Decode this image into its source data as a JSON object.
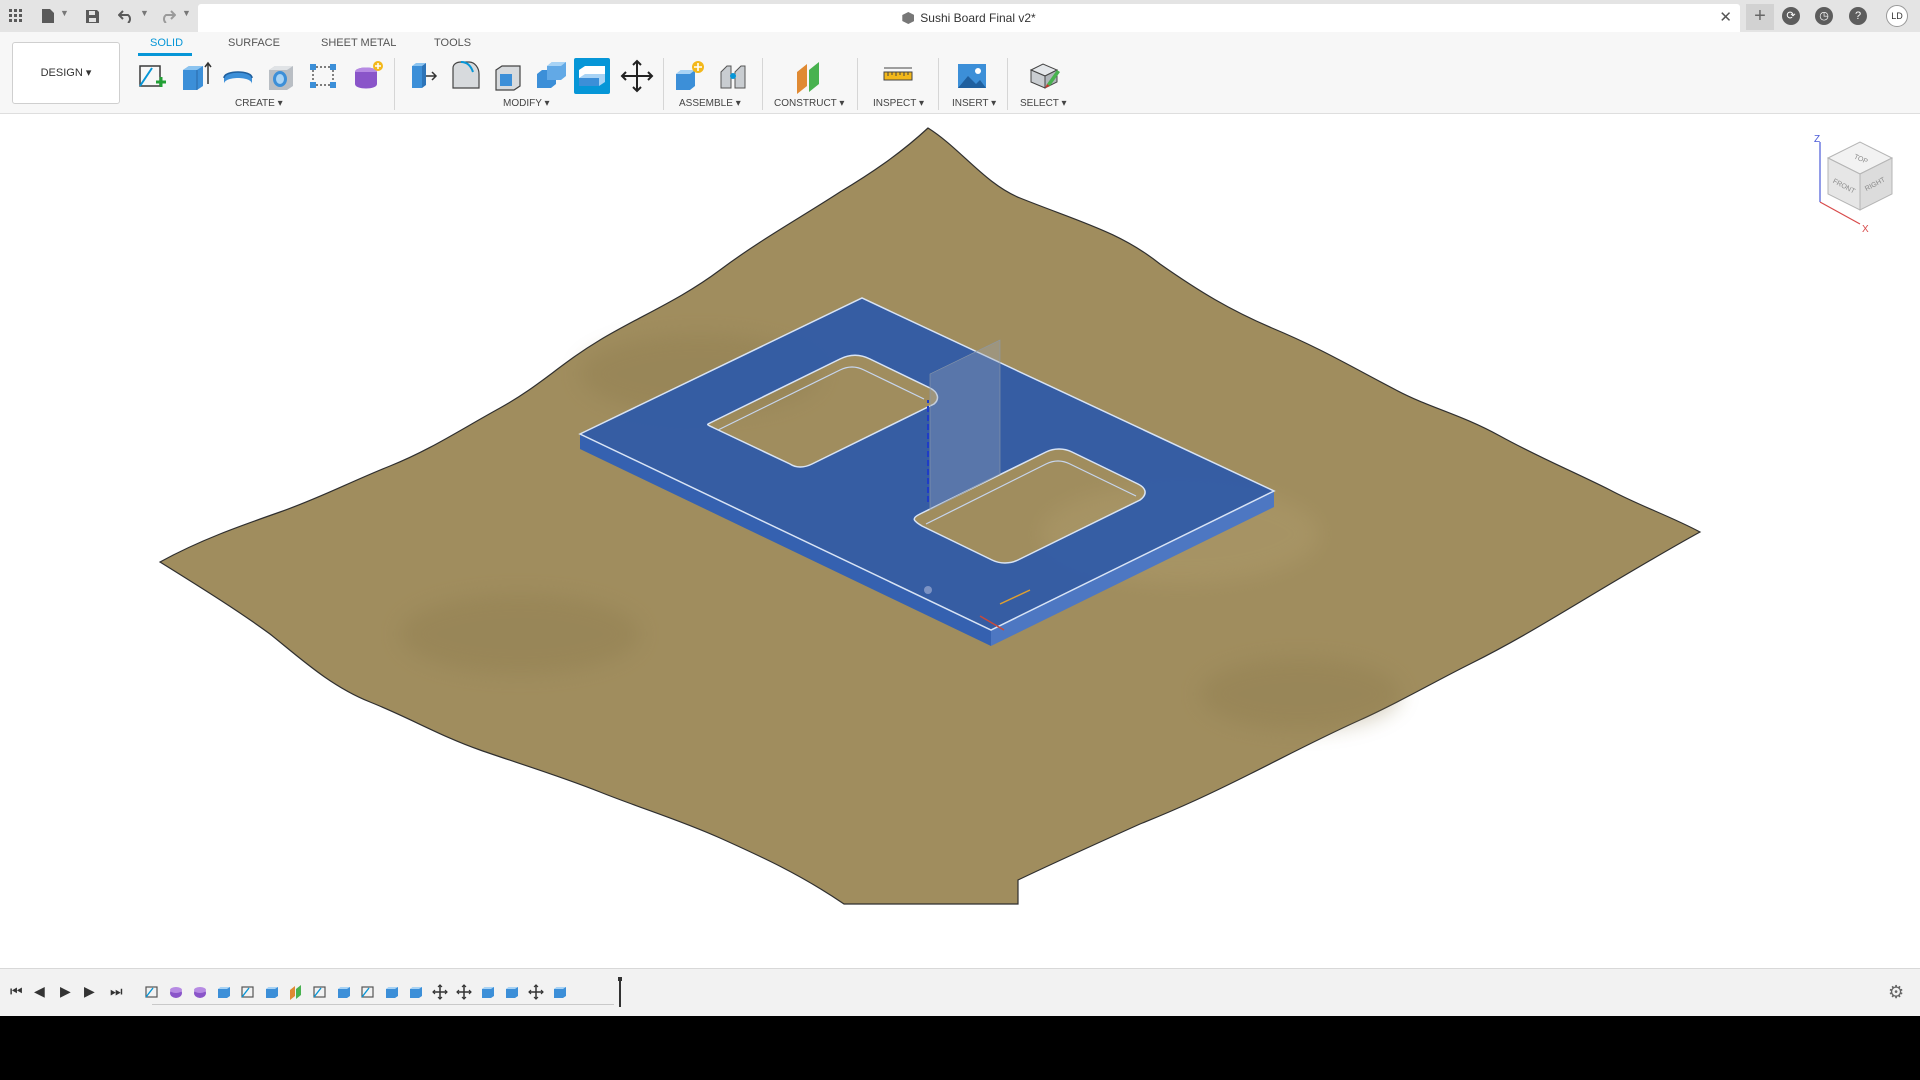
{
  "titlebar": {
    "document_title": "Sushi Board Final v2*",
    "user_initials": "LD",
    "icons": [
      "apps-grid-icon",
      "file-icon",
      "save-icon",
      "undo-icon",
      "redo-icon",
      "close-icon",
      "plus-icon",
      "extensions-icon",
      "job-status-icon",
      "help-icon"
    ]
  },
  "toolbar": {
    "workspace_label": "DESIGN",
    "tabs": [
      {
        "label": "SOLID",
        "active": true
      },
      {
        "label": "SURFACE",
        "active": false
      },
      {
        "label": "SHEET METAL",
        "active": false
      },
      {
        "label": "TOOLS",
        "active": false
      }
    ],
    "groups": {
      "create": "CREATE",
      "modify": "MODIFY",
      "assemble": "ASSEMBLE",
      "construct": "CONSTRUCT",
      "inspect": "INSPECT",
      "insert": "INSERT",
      "select": "SELECT"
    },
    "tools": {
      "create": [
        "create-sketch-icon",
        "extrude-icon",
        "revolve-icon",
        "hole-icon",
        "pattern-icon",
        "create-form-icon"
      ],
      "modify": [
        "press-pull-icon",
        "fillet-icon",
        "shell-icon",
        "combine-icon",
        "offset-face-icon",
        "move-copy-icon"
      ],
      "assemble": [
        "new-component-icon",
        "joint-icon"
      ],
      "construct": [
        "offset-plane-icon"
      ],
      "inspect": [
        "measure-icon"
      ],
      "insert": [
        "insert-image-icon"
      ],
      "select": [
        "select-icon"
      ]
    }
  },
  "viewcube": {
    "top": "TOP",
    "front": "FRONT",
    "right": "RIGHT",
    "axis_z": "Z",
    "axis_x": "X"
  },
  "colors": {
    "terrain": "#a08d5e",
    "board": "#2f5aa8",
    "accent": "#0696d7"
  },
  "timeline": {
    "controls": [
      "skip-start-icon",
      "step-back-icon",
      "play-icon",
      "step-forward-icon",
      "skip-end-icon"
    ],
    "features": [
      "sketch",
      "form",
      "form",
      "extrude",
      "sketch",
      "extrude",
      "plane",
      "sketch",
      "extrude",
      "sketch",
      "extrude",
      "extrude",
      "move",
      "move",
      "extrude",
      "extrude",
      "move",
      "extrude"
    ]
  }
}
